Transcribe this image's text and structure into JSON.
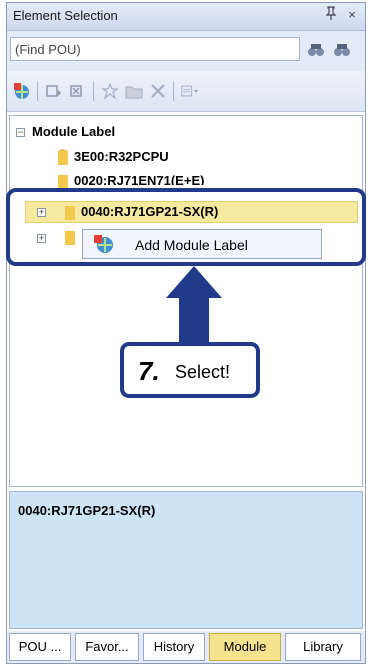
{
  "window": {
    "title": "Element Selection",
    "pin_glyph": "4",
    "close_glyph": "×"
  },
  "search": {
    "value": "(Find POU)"
  },
  "tree": {
    "root_label": "Module Label",
    "items": [
      {
        "label": "3E00:R32PCPU"
      },
      {
        "label": "0020:RJ71EN71(E+E)"
      },
      {
        "label": "0040:RJ71GP21-SX(R)"
      }
    ]
  },
  "context_menu": {
    "item_label": "Add Module Label"
  },
  "annotation": {
    "step_number": "7.",
    "step_text": "Select!"
  },
  "detail": {
    "text": "0040:RJ71GP21-SX(R)"
  },
  "tabs": [
    {
      "label": "POU ..."
    },
    {
      "label": "Favor..."
    },
    {
      "label": "History"
    },
    {
      "label": "Module"
    },
    {
      "label": "Library"
    }
  ],
  "colors": {
    "accent": "#223a8a",
    "selection": "#f6eaa1",
    "active_tab": "#f6e38d",
    "detail_bg": "#cde3f6"
  }
}
